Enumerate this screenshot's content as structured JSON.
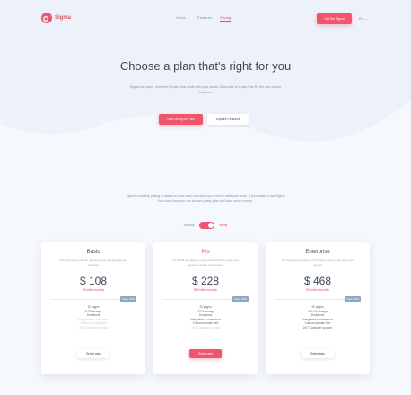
{
  "header": {
    "brand": "Sigma",
    "nav": [
      "Home",
      "Features",
      "Pricing"
    ],
    "active_nav": "Pricing",
    "cta": "Get the Sigma",
    "lang": "En"
  },
  "hero": {
    "title": "Choose a plan that's right for you",
    "subtitle": "Sigma has plans, from free to paid, that scale with your needs. Subscribe to a plan that fits the size of your business.",
    "primary_button": "Start Using for Free",
    "secondary_button": "Explore Features"
  },
  "intro": "Sigma's monthly pricing is based on how many functions you need to start your work. If you ready to use Sigma for a long time you can choose yearly plan and save some money.",
  "billing": {
    "monthly": "Monthly",
    "yearly": "Yearly"
  },
  "plans": [
    {
      "name": "Basic",
      "desc": "This is the basic plan for getting started and growing your business",
      "price": "$ 108",
      "billed": "$9 billed monthly",
      "save": "Save 20%",
      "features": [
        "10 pages",
        "5 Gb storage",
        "Donations",
        "Integrated e-commerce",
        "Custom domain free",
        "24/7 Customer support"
      ],
      "features_off": [
        false,
        false,
        false,
        true,
        true,
        true
      ],
      "select": "Select plan"
    },
    {
      "name": "Pro",
      "desc": "For Small and agency teams that work with a large and growing number of instances",
      "price": "$ 228",
      "billed": "$19 billed monthly",
      "save": "Save 20%",
      "features": [
        "20 pages",
        "18 Gb storage",
        "Donations",
        "Integrated e-commerce",
        "Custom domain free",
        "24/7 Customer support"
      ],
      "features_off": [
        false,
        false,
        false,
        false,
        false,
        true
      ],
      "select": "Select plan"
    },
    {
      "name": "Enterprise",
      "desc": "For agencies and teams with custom options and expert live support",
      "price": "$ 468",
      "billed": "$39 billed monthly",
      "save": "Save 20%",
      "features": [
        "90 pages",
        "100 Gb storage",
        "Donations",
        "Integrated e-commerce",
        "Custom domain free",
        "24/7 Customer support"
      ],
      "features_off": [
        false,
        false,
        false,
        false,
        false,
        false
      ],
      "select": "Select plan"
    }
  ],
  "colors": {
    "accent": "#f0556b",
    "badge": "#8fa6c8",
    "text": "#3c4858",
    "muted": "#8492a6"
  }
}
